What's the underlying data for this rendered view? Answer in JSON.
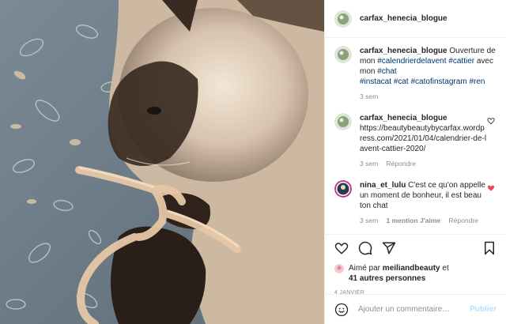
{
  "post": {
    "author": "carfax_henecia_blogue",
    "caption": {
      "author": "carfax_henecia_blogue",
      "text_parts": [
        {
          "text": " Ouverture de mon ",
          "tag": false
        },
        {
          "text": "#calendrierdelavent",
          "tag": true
        },
        {
          "text": " ",
          "tag": false
        },
        {
          "text": "#cattier",
          "tag": true
        },
        {
          "text": " avec mon ",
          "tag": false
        },
        {
          "text": "#chat",
          "tag": true
        }
      ],
      "hashtags_line": [
        "#instacat",
        "#cat",
        "#catofinstagram",
        "#ren"
      ],
      "time": "3 sem"
    },
    "comments": [
      {
        "author": "carfax_henecia_blogue",
        "text": "https://beautybeautybycarfax.wordpress.com/2021/01/04/calendrier-de-lavent-cattier-2020/",
        "time": "3 sem",
        "reply": "Répondre",
        "liked": false
      },
      {
        "author": "nina_et_lulu",
        "text": " C'est ce qu'on appelle un moment de bonheur, il est beau ton chat",
        "time": "3 sem",
        "likes": "1 mention J'aime",
        "reply": "Répondre",
        "liked": true
      }
    ],
    "likes": {
      "prefix": "Aimé par ",
      "user": "meiliandbeauty",
      "mid": " et",
      "others": "41 autres personnes"
    },
    "date": "4 JANVIER",
    "add_comment": {
      "placeholder": "Ajouter un commentaire…",
      "publish": "Publier"
    }
  },
  "colors": {
    "link": "#00376b",
    "muted": "#8e8e8e",
    "heart_red": "#ed4956",
    "publish_disabled": "#b2dffc"
  },
  "icons": [
    "heart-icon",
    "comment-icon",
    "share-icon",
    "bookmark-icon",
    "smiley-icon"
  ]
}
